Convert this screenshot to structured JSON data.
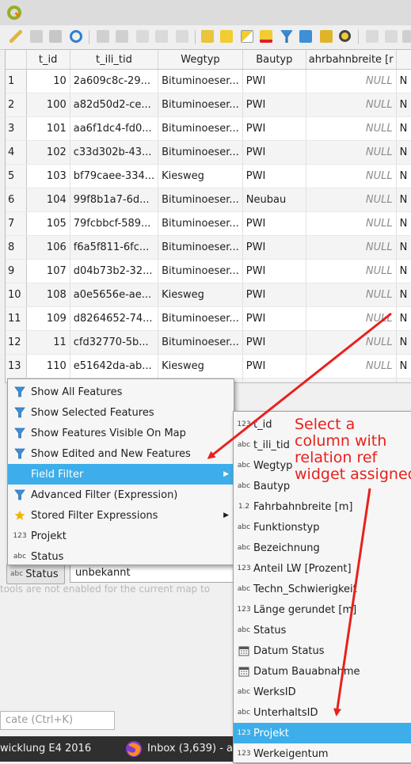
{
  "table": {
    "columns": [
      "t_id",
      "t_ili_tid",
      "Wegtyp",
      "Bautyp",
      "ahrbahnbreite [r"
    ],
    "rows": [
      {
        "row": "1",
        "t_id": "10",
        "t_ili_tid": "2a609c8c-29...",
        "wegtyp": "Bituminoeser...",
        "bautyp": "PWI",
        "breite": "NULL"
      },
      {
        "row": "2",
        "t_id": "100",
        "t_ili_tid": "a82d50d2-ce...",
        "wegtyp": "Bituminoeser...",
        "bautyp": "PWI",
        "breite": "NULL"
      },
      {
        "row": "3",
        "t_id": "101",
        "t_ili_tid": "aa6f1dc4-fd0...",
        "wegtyp": "Bituminoeser...",
        "bautyp": "PWI",
        "breite": "NULL"
      },
      {
        "row": "4",
        "t_id": "102",
        "t_ili_tid": "c33d302b-43...",
        "wegtyp": "Bituminoeser...",
        "bautyp": "PWI",
        "breite": "NULL"
      },
      {
        "row": "5",
        "t_id": "103",
        "t_ili_tid": "bf79caee-334...",
        "wegtyp": "Kiesweg",
        "bautyp": "PWI",
        "breite": "NULL"
      },
      {
        "row": "6",
        "t_id": "104",
        "t_ili_tid": "99f8b1a7-6d...",
        "wegtyp": "Bituminoeser...",
        "bautyp": "Neubau",
        "breite": "NULL"
      },
      {
        "row": "7",
        "t_id": "105",
        "t_ili_tid": "79fcbbcf-589...",
        "wegtyp": "Bituminoeser...",
        "bautyp": "PWI",
        "breite": "NULL"
      },
      {
        "row": "8",
        "t_id": "106",
        "t_ili_tid": "f6a5f811-6fc...",
        "wegtyp": "Bituminoeser...",
        "bautyp": "PWI",
        "breite": "NULL"
      },
      {
        "row": "9",
        "t_id": "107",
        "t_ili_tid": "d04b73b2-32...",
        "wegtyp": "Bituminoeser...",
        "bautyp": "PWI",
        "breite": "NULL"
      },
      {
        "row": "10",
        "t_id": "108",
        "t_ili_tid": "a0e5656e-ae...",
        "wegtyp": "Kiesweg",
        "bautyp": "PWI",
        "breite": "NULL"
      },
      {
        "row": "11",
        "t_id": "109",
        "t_ili_tid": "d8264652-74...",
        "wegtyp": "Bituminoeser...",
        "bautyp": "PWI",
        "breite": "NULL"
      },
      {
        "row": "12",
        "t_id": "11",
        "t_ili_tid": "cfd32770-5b...",
        "wegtyp": "Bituminoeser...",
        "bautyp": "PWI",
        "breite": "NULL"
      },
      {
        "row": "13",
        "t_id": "110",
        "t_ili_tid": "e51642da-ab...",
        "wegtyp": "Kiesweg",
        "bautyp": "PWI",
        "breite": "NULL"
      },
      {
        "row": "",
        "t_id": "",
        "t_ili_tid": "",
        "wegtyp": "",
        "bautyp": "PWI",
        "breite": "NULL"
      }
    ],
    "extra_col_cell": "N"
  },
  "filter_menu": {
    "items": [
      {
        "label": "Show All Features",
        "icon": "filter-icon"
      },
      {
        "label": "Show Selected Features",
        "icon": "filter-icon"
      },
      {
        "label": "Show Features Visible On Map",
        "icon": "filter-icon"
      },
      {
        "label": "Show Edited and New Features",
        "icon": "filter-icon"
      },
      {
        "label": "Field Filter",
        "icon": "",
        "submenu": true,
        "selected": true
      },
      {
        "label": "Advanced Filter (Expression)",
        "icon": "filter-icon"
      },
      {
        "label": "Stored Filter Expressions",
        "icon": "star-icon",
        "submenu": true
      },
      {
        "label": "Projekt",
        "icon": "123"
      },
      {
        "label": "Status",
        "icon": "abc"
      }
    ]
  },
  "field_menu": {
    "items": [
      {
        "label": "t_id",
        "icon": "123"
      },
      {
        "label": "t_ili_tid",
        "icon": "abc"
      },
      {
        "label": "Wegtyp",
        "icon": "abc"
      },
      {
        "label": "Bautyp",
        "icon": "abc"
      },
      {
        "label": "Fahrbahnbreite [m]",
        "icon": "1.2"
      },
      {
        "label": "Funktionstyp",
        "icon": "abc"
      },
      {
        "label": "Bezeichnung",
        "icon": "abc"
      },
      {
        "label": "Anteil LW [Prozent]",
        "icon": "123"
      },
      {
        "label": "Techn_Schwierigkeit",
        "icon": "abc"
      },
      {
        "label": "Länge gerundet [m]",
        "icon": "123"
      },
      {
        "label": "Status",
        "icon": "abc"
      },
      {
        "label": "Datum Status",
        "icon": "calendar"
      },
      {
        "label": "Datum Bauabnahme",
        "icon": "calendar"
      },
      {
        "label": "WerksID",
        "icon": "abc"
      },
      {
        "label": "UnterhaltsID",
        "icon": "abc"
      },
      {
        "label": "Projekt",
        "icon": "123",
        "selected": true
      },
      {
        "label": "Werkeigentum",
        "icon": "123"
      }
    ]
  },
  "bottom": {
    "field_button_type": "abc",
    "field_button_label": "Status",
    "filter_value": "unbekannt",
    "faded_text": "tools are not enabled for the current map to",
    "locator_placeholder": "cate (Ctrl+K)"
  },
  "taskbar": {
    "item1": "wicklung E4 2016",
    "item2": "Inbox (3,639) - and"
  },
  "annotation": {
    "text": "Select a\ncolumn with\nrelation ref\nwidget assigned."
  },
  "colors": {
    "selection": "#3daee9",
    "annotation": "#e8211d",
    "filter_icon": "#3d8fd6",
    "star_icon": "#f0b400"
  }
}
